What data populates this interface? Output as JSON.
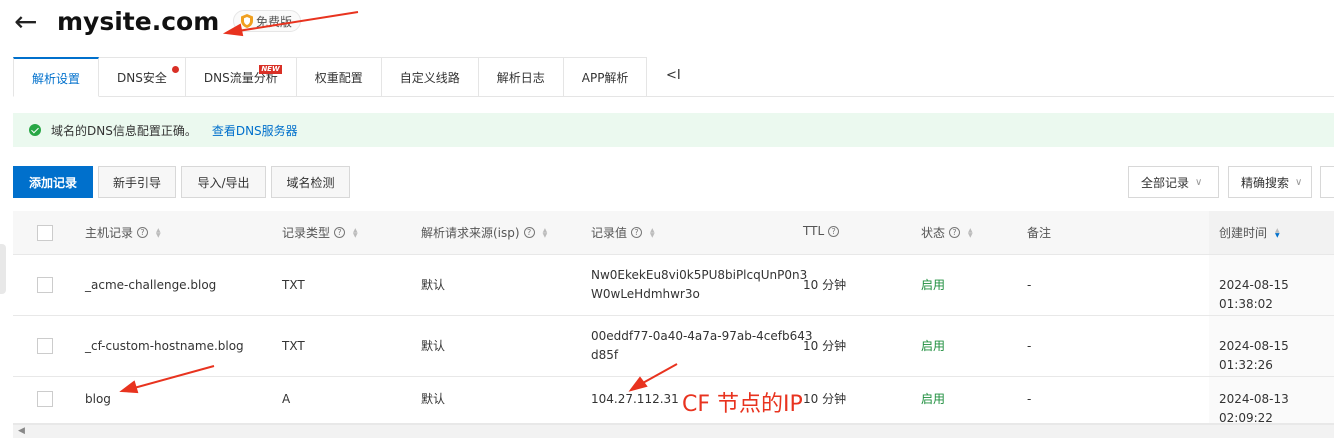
{
  "header": {
    "back_icon": "←",
    "title": "mysite.com",
    "badge": "免费版"
  },
  "tabs": [
    {
      "label": "解析设置",
      "active": true
    },
    {
      "label": "DNS安全",
      "dot": true
    },
    {
      "label": "DNS流量分析",
      "tag": "NEW"
    },
    {
      "label": "权重配置"
    },
    {
      "label": "自定义线路"
    },
    {
      "label": "解析日志"
    },
    {
      "label": "APP解析"
    }
  ],
  "collapse_icon": "<I",
  "alert": {
    "message": "域名的DNS信息配置正确。",
    "link": "查看DNS服务器"
  },
  "toolbar": {
    "add": "添加记录",
    "guide": "新手引导",
    "import_export": "导入/导出",
    "check": "域名检测",
    "filter": "全部记录",
    "search": "精确搜索"
  },
  "table": {
    "headers": {
      "host": "主机记录",
      "type": "记录类型",
      "isp": "解析请求来源(isp)",
      "value": "记录值",
      "ttl": "TTL",
      "status": "状态",
      "remark": "备注",
      "created": "创建时间"
    },
    "rows": [
      {
        "host": "_acme-challenge.blog",
        "type": "TXT",
        "isp": "默认",
        "value_l1": "Nw0EkekEu8vi0k5PU8biPlcqUnP0n3",
        "value_l2": "W0wLeHdmhwr3o",
        "ttl": "10 分钟",
        "status": "启用",
        "remark": "-",
        "created": "2024-08-15 01:38:02"
      },
      {
        "host": "_cf-custom-hostname.blog",
        "type": "TXT",
        "isp": "默认",
        "value_l1": "00eddf77-0a40-4a7a-97ab-4cefb643",
        "value_l2": "d85f",
        "ttl": "10 分钟",
        "status": "启用",
        "remark": "-",
        "created": "2024-08-15 01:32:26"
      },
      {
        "host": "blog",
        "type": "A",
        "isp": "默认",
        "value_l1": "104.27.112.31",
        "value_l2": "",
        "ttl": "10 分钟",
        "status": "启用",
        "remark": "-",
        "created": "2024-08-13 02:09:22"
      }
    ]
  },
  "annotation": {
    "text": "CF 节点的IP",
    "color": "#e8331f"
  },
  "colors": {
    "accent": "#0070cc",
    "enabled": "#1e8e3e",
    "alert_bg": "#ebf9ef"
  }
}
